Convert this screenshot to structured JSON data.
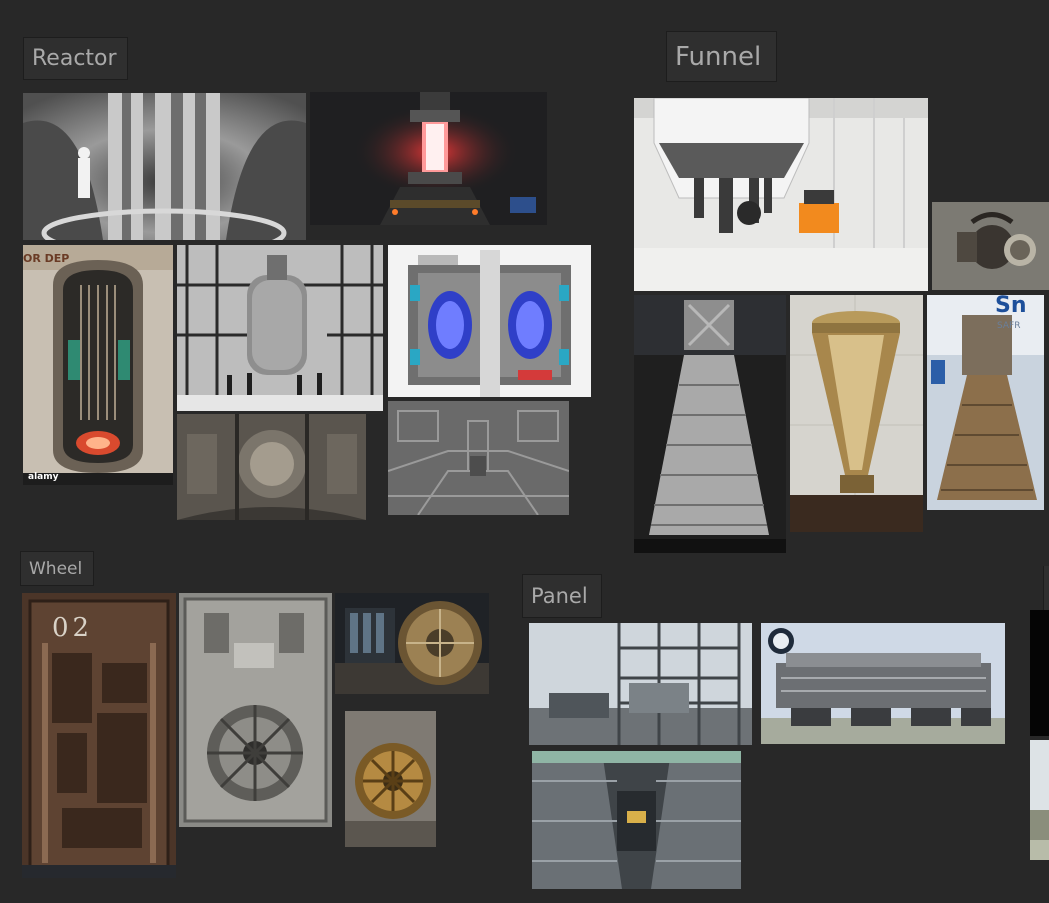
{
  "groups": {
    "reactor": {
      "label": "Reactor"
    },
    "funnel": {
      "label": "Funnel"
    },
    "wheel": {
      "label": "Wheel"
    },
    "panel": {
      "label": "Panel"
    }
  },
  "image_text": {
    "door_number": "02",
    "alamy_mark": "alamy",
    "sn_mark": "Sn",
    "safr_mark": "SAFR",
    "sign_text": "OR DEP"
  },
  "colors": {
    "board_background": "#282828",
    "label_background": "#2f2f2f",
    "label_text": "#a9a9a9"
  }
}
